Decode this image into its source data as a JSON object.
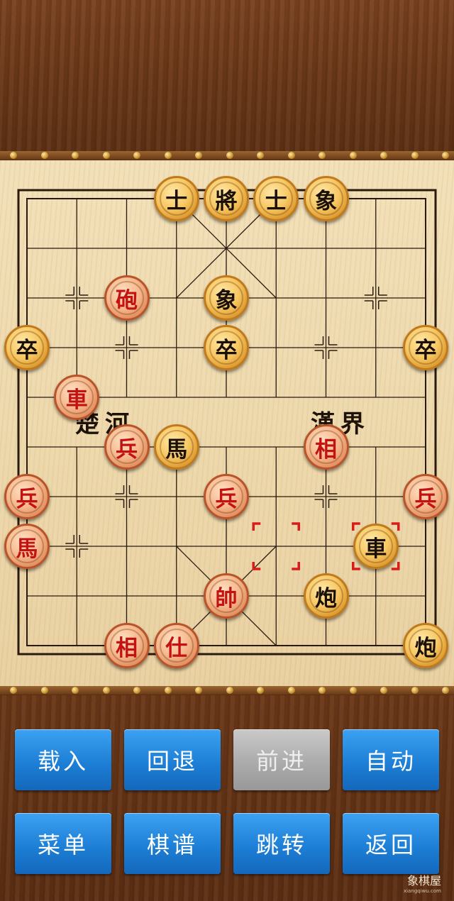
{
  "board": {
    "river_left": "楚河",
    "river_right": "漢界"
  },
  "pieces": [
    {
      "char": "士",
      "side": "black",
      "col": 3,
      "row": 0
    },
    {
      "char": "將",
      "side": "black",
      "col": 4,
      "row": 0
    },
    {
      "char": "士",
      "side": "black",
      "col": 5,
      "row": 0
    },
    {
      "char": "象",
      "side": "black",
      "col": 6,
      "row": 0
    },
    {
      "char": "砲",
      "side": "red",
      "col": 2,
      "row": 2
    },
    {
      "char": "象",
      "side": "black",
      "col": 4,
      "row": 2
    },
    {
      "char": "卒",
      "side": "black",
      "col": 0,
      "row": 3
    },
    {
      "char": "卒",
      "side": "black",
      "col": 4,
      "row": 3
    },
    {
      "char": "卒",
      "side": "black",
      "col": 8,
      "row": 3
    },
    {
      "char": "車",
      "side": "red",
      "col": 1,
      "row": 4
    },
    {
      "char": "兵",
      "side": "red",
      "col": 2,
      "row": 5
    },
    {
      "char": "馬",
      "side": "black",
      "col": 3,
      "row": 5
    },
    {
      "char": "相",
      "side": "red",
      "col": 6,
      "row": 5
    },
    {
      "char": "兵",
      "side": "red",
      "col": 0,
      "row": 6
    },
    {
      "char": "兵",
      "side": "red",
      "col": 4,
      "row": 6
    },
    {
      "char": "兵",
      "side": "red",
      "col": 8,
      "row": 6
    },
    {
      "char": "馬",
      "side": "red",
      "col": 0,
      "row": 7
    },
    {
      "char": "車",
      "side": "black",
      "col": 7,
      "row": 7
    },
    {
      "char": "帥",
      "side": "red",
      "col": 4,
      "row": 8
    },
    {
      "char": "炮",
      "side": "black",
      "col": 6,
      "row": 8
    },
    {
      "char": "相",
      "side": "red",
      "col": 2,
      "row": 9
    },
    {
      "char": "仕",
      "side": "red",
      "col": 3,
      "row": 9
    },
    {
      "char": "炮",
      "side": "black",
      "col": 8,
      "row": 9
    }
  ],
  "last_move": {
    "from": {
      "col": 5,
      "row": 7
    },
    "to": {
      "col": 7,
      "row": 7
    }
  },
  "controls": {
    "load": "载入",
    "undo": "回退",
    "forward": "前进",
    "auto": "自动",
    "menu": "菜单",
    "records": "棋谱",
    "jump": "跳转",
    "back": "返回"
  },
  "watermark": {
    "brand": "象棋屋",
    "site": "xiangqiwu.com"
  }
}
